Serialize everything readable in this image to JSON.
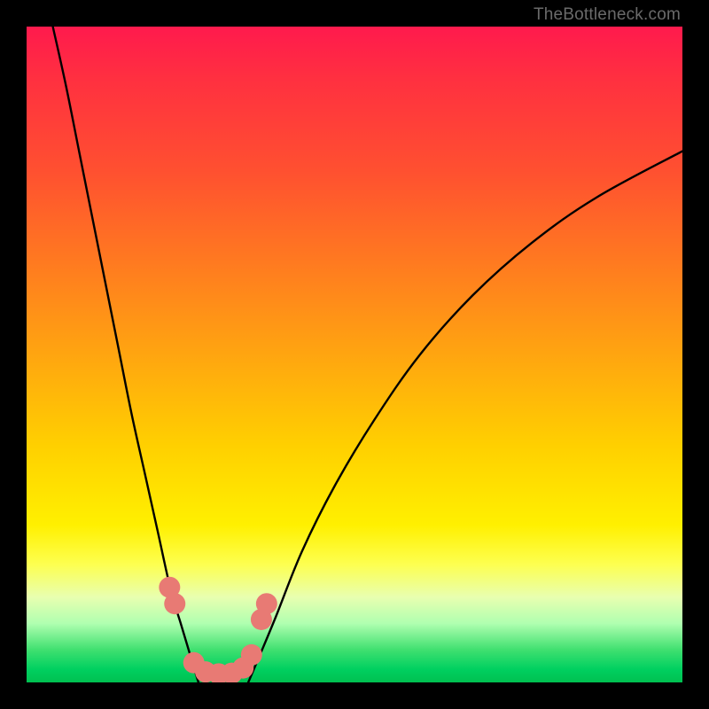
{
  "watermark": "TheBottleneck.com",
  "chart_data": {
    "type": "line",
    "title": "",
    "xlabel": "",
    "ylabel": "",
    "ylim": [
      0,
      100
    ],
    "xlim": [
      0,
      100
    ],
    "series": [
      {
        "name": "curve-left",
        "x": [
          4,
          6,
          8,
          10,
          12,
          14,
          16,
          18,
          20,
          22,
          23.5,
          25,
          26.2
        ],
        "y": [
          100,
          91,
          81,
          71,
          61,
          51,
          41,
          32,
          23,
          14,
          9,
          4,
          0
        ]
      },
      {
        "name": "curve-right",
        "x": [
          33.8,
          35.5,
          38,
          42,
          47,
          53,
          60,
          68,
          77,
          87,
          100
        ],
        "y": [
          0,
          4,
          10,
          20,
          30,
          40,
          50,
          59,
          67,
          74,
          81
        ]
      }
    ],
    "markers": {
      "name": "dots",
      "color": "#e87a74",
      "radius": 12,
      "points": [
        {
          "x": 21.8,
          "y": 14.5
        },
        {
          "x": 22.6,
          "y": 12.0
        },
        {
          "x": 25.5,
          "y": 3.0
        },
        {
          "x": 27.3,
          "y": 1.6
        },
        {
          "x": 29.3,
          "y": 1.3
        },
        {
          "x": 31.3,
          "y": 1.4
        },
        {
          "x": 33.0,
          "y": 2.2
        },
        {
          "x": 34.3,
          "y": 4.2
        },
        {
          "x": 35.8,
          "y": 9.6
        },
        {
          "x": 36.6,
          "y": 12.0
        }
      ]
    }
  }
}
